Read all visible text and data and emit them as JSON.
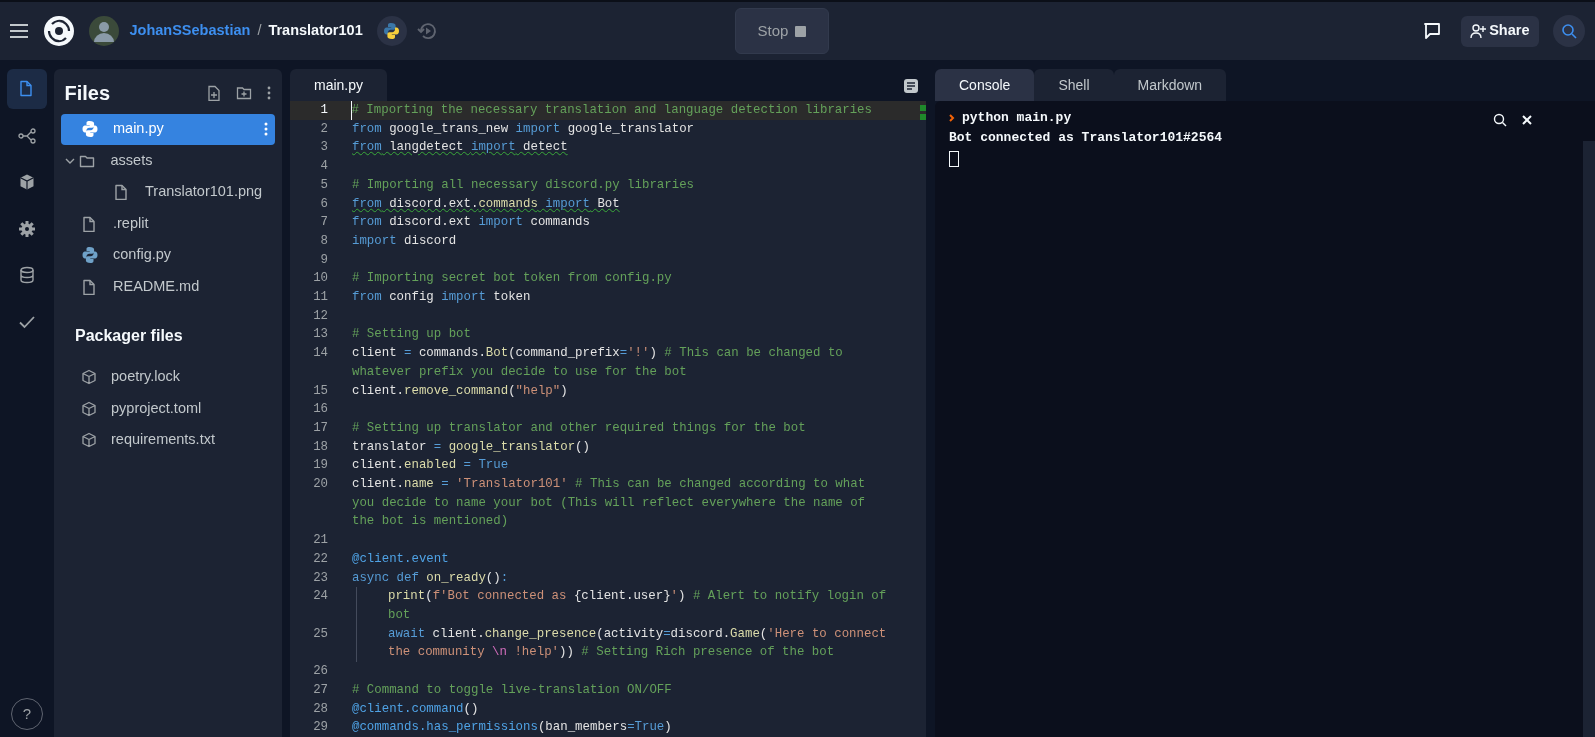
{
  "topbar": {
    "user": "JohanSSebastian",
    "separator": "/",
    "repl": "Translator101",
    "run_button": {
      "label": "Stop"
    },
    "share_button": {
      "label": "Share"
    }
  },
  "activity_bar": [
    {
      "kind": "files",
      "selected": true
    },
    {
      "kind": "git",
      "selected": false
    },
    {
      "kind": "packages",
      "selected": false
    },
    {
      "kind": "settings",
      "selected": false
    },
    {
      "kind": "database",
      "selected": false
    },
    {
      "kind": "tests",
      "selected": false
    }
  ],
  "help": "?",
  "files_panel": {
    "title": "Files",
    "items": [
      {
        "name": "main.py",
        "kind": "python",
        "selected": true
      },
      {
        "name": "assets",
        "kind": "folder",
        "selected": false,
        "expanded": true,
        "children": [
          {
            "name": "Translator101.png",
            "kind": "file",
            "selected": false
          }
        ]
      },
      {
        "name": ".replit",
        "kind": "file",
        "selected": false
      },
      {
        "name": "config.py",
        "kind": "python",
        "selected": false
      },
      {
        "name": "README.md",
        "kind": "file",
        "selected": false
      }
    ],
    "packager_title": "Packager files",
    "packager_items": [
      {
        "name": "poetry.lock"
      },
      {
        "name": "pyproject.toml"
      },
      {
        "name": "requirements.txt"
      }
    ]
  },
  "editor": {
    "tabs": [
      {
        "label": "main.py",
        "selected": true
      }
    ],
    "lines": [
      {
        "n": "1",
        "active": true,
        "rows": [
          {
            "tokens": [
              {
                "kind": "c",
                "text": "# Importing the necessary translation and language detection libraries"
              }
            ]
          }
        ]
      },
      {
        "n": "2",
        "rows": [
          {
            "tokens": [
              {
                "kind": "k",
                "text": "from"
              },
              {
                "kind": "t",
                "text": " google_trans_new "
              },
              {
                "kind": "k",
                "text": "import"
              },
              {
                "kind": "t",
                "text": " google_translator"
              }
            ]
          }
        ]
      },
      {
        "n": "3",
        "warning": true,
        "rows": [
          {
            "tokens": [
              {
                "kind": "k",
                "text": "from"
              },
              {
                "kind": "t",
                "text": " langdetect "
              },
              {
                "kind": "k",
                "text": "import"
              },
              {
                "kind": "t",
                "text": " detect"
              }
            ]
          }
        ]
      },
      {
        "n": "4",
        "rows": [
          {
            "tokens": []
          }
        ]
      },
      {
        "n": "5",
        "rows": [
          {
            "tokens": [
              {
                "kind": "c",
                "text": "# Importing all necessary discord.py libraries"
              }
            ]
          }
        ]
      },
      {
        "n": "6",
        "warning": true,
        "rows": [
          {
            "tokens": [
              {
                "kind": "k",
                "text": "from"
              },
              {
                "kind": "t",
                "text": " discord.ext."
              },
              {
                "kind": "f",
                "text": "commands"
              },
              {
                "kind": "k",
                "text": " import"
              },
              {
                "kind": "t",
                "text": " Bot"
              }
            ]
          }
        ]
      },
      {
        "n": "7",
        "rows": [
          {
            "tokens": [
              {
                "kind": "k",
                "text": "from"
              },
              {
                "kind": "t",
                "text": " discord.ext "
              },
              {
                "kind": "k",
                "text": "import"
              },
              {
                "kind": "t",
                "text": " commands"
              }
            ]
          }
        ]
      },
      {
        "n": "8",
        "rows": [
          {
            "tokens": [
              {
                "kind": "k",
                "text": "import"
              },
              {
                "kind": "t",
                "text": " discord"
              }
            ]
          }
        ]
      },
      {
        "n": "9",
        "rows": [
          {
            "tokens": []
          }
        ]
      },
      {
        "n": "10",
        "rows": [
          {
            "tokens": [
              {
                "kind": "c",
                "text": "# Importing secret bot token from config.py"
              }
            ]
          }
        ]
      },
      {
        "n": "11",
        "rows": [
          {
            "tokens": [
              {
                "kind": "k",
                "text": "from"
              },
              {
                "kind": "t",
                "text": " config "
              },
              {
                "kind": "k",
                "text": "import"
              },
              {
                "kind": "t",
                "text": " token"
              }
            ]
          }
        ]
      },
      {
        "n": "12",
        "rows": [
          {
            "tokens": []
          }
        ]
      },
      {
        "n": "13",
        "rows": [
          {
            "tokens": [
              {
                "kind": "c",
                "text": "# Setting up bot"
              }
            ]
          }
        ]
      },
      {
        "n": "14",
        "rows": [
          {
            "tokens": [
              {
                "kind": "t",
                "text": "client "
              },
              {
                "kind": "o",
                "text": "="
              },
              {
                "kind": "t",
                "text": " commands."
              },
              {
                "kind": "f",
                "text": "Bot"
              },
              {
                "kind": "t",
                "text": "(command_prefix"
              },
              {
                "kind": "o",
                "text": "="
              },
              {
                "kind": "s",
                "text": "'!'"
              },
              {
                "kind": "t",
                "text": ") "
              },
              {
                "kind": "c",
                "text": "# This can be changed to"
              }
            ]
          },
          {
            "tokens": [
              {
                "kind": "c",
                "text": "whatever prefix you decide to use for the bot"
              }
            ]
          }
        ]
      },
      {
        "n": "15",
        "rows": [
          {
            "tokens": [
              {
                "kind": "t",
                "text": "client."
              },
              {
                "kind": "f",
                "text": "remove_command"
              },
              {
                "kind": "t",
                "text": "("
              },
              {
                "kind": "s",
                "text": "\"help\""
              },
              {
                "kind": "t",
                "text": ")"
              }
            ]
          }
        ]
      },
      {
        "n": "16",
        "rows": [
          {
            "tokens": []
          }
        ]
      },
      {
        "n": "17",
        "rows": [
          {
            "tokens": [
              {
                "kind": "c",
                "text": "# Setting up translator and other required things for the bot"
              }
            ]
          }
        ]
      },
      {
        "n": "18",
        "rows": [
          {
            "tokens": [
              {
                "kind": "t",
                "text": "translator "
              },
              {
                "kind": "o",
                "text": "="
              },
              {
                "kind": "f",
                "text": " google_translator"
              },
              {
                "kind": "t",
                "text": "()"
              }
            ]
          }
        ]
      },
      {
        "n": "19",
        "rows": [
          {
            "tokens": [
              {
                "kind": "t",
                "text": "client."
              },
              {
                "kind": "f",
                "text": "enabled"
              },
              {
                "kind": "o",
                "text": " ="
              },
              {
                "kind": "k",
                "text": " True"
              }
            ]
          }
        ]
      },
      {
        "n": "20",
        "rows": [
          {
            "tokens": [
              {
                "kind": "t",
                "text": "client."
              },
              {
                "kind": "f",
                "text": "name"
              },
              {
                "kind": "o",
                "text": " ="
              },
              {
                "kind": "s",
                "text": " 'Translator101'"
              },
              {
                "kind": "c",
                "text": " # This can be changed according to what"
              }
            ]
          },
          {
            "tokens": [
              {
                "kind": "c",
                "text": "you decide to name your bot (This will reflect everywhere the name of"
              }
            ]
          },
          {
            "tokens": [
              {
                "kind": "c",
                "text": "the bot is mentioned)"
              }
            ]
          }
        ]
      },
      {
        "n": "21",
        "rows": [
          {
            "tokens": []
          }
        ]
      },
      {
        "n": "22",
        "rows": [
          {
            "tokens": [
              {
                "kind": "d",
                "text": "@client.event"
              }
            ]
          }
        ]
      },
      {
        "n": "23",
        "rows": [
          {
            "tokens": [
              {
                "kind": "k",
                "text": "async"
              },
              {
                "kind": "k",
                "text": " def"
              },
              {
                "kind": "f",
                "text": " on_ready"
              },
              {
                "kind": "t",
                "text": "()"
              },
              {
                "kind": "o",
                "text": ":"
              }
            ]
          }
        ]
      },
      {
        "n": "24",
        "indented": true,
        "rows": [
          {
            "tokens": [
              {
                "kind": "f",
                "text": "print"
              },
              {
                "kind": "t",
                "text": "("
              },
              {
                "kind": "s",
                "text": "f'Bot connected as "
              },
              {
                "kind": "t",
                "text": "{client.user}"
              },
              {
                "kind": "s",
                "text": "'"
              },
              {
                "kind": "t",
                "text": ") "
              },
              {
                "kind": "c",
                "text": "# Alert to notify login of"
              }
            ]
          },
          {
            "tokens": [
              {
                "kind": "c",
                "text": "bot"
              }
            ]
          }
        ]
      },
      {
        "n": "25",
        "indented": true,
        "rows": [
          {
            "tokens": [
              {
                "kind": "k",
                "text": "await"
              },
              {
                "kind": "t",
                "text": " client."
              },
              {
                "kind": "f",
                "text": "change_presence"
              },
              {
                "kind": "t",
                "text": "(activity"
              },
              {
                "kind": "o",
                "text": "="
              },
              {
                "kind": "t",
                "text": "discord."
              },
              {
                "kind": "f",
                "text": "Game"
              },
              {
                "kind": "t",
                "text": "("
              },
              {
                "kind": "s",
                "text": "'Here to connect"
              }
            ]
          },
          {
            "tokens": [
              {
                "kind": "s",
                "text": "the community "
              },
              {
                "kind": "e",
                "text": "\\n"
              },
              {
                "kind": "s",
                "text": " !help'"
              },
              {
                "kind": "t",
                "text": ")) "
              },
              {
                "kind": "c",
                "text": "# Setting Rich presence of the bot"
              }
            ]
          }
        ]
      },
      {
        "n": "26",
        "rows": [
          {
            "tokens": []
          }
        ]
      },
      {
        "n": "27",
        "rows": [
          {
            "tokens": [
              {
                "kind": "c",
                "text": "# Command to toggle live-translation ON/OFF"
              }
            ]
          }
        ]
      },
      {
        "n": "28",
        "rows": [
          {
            "tokens": [
              {
                "kind": "d",
                "text": "@client.command"
              },
              {
                "kind": "t",
                "text": "()"
              }
            ]
          }
        ]
      },
      {
        "n": "29",
        "rows": [
          {
            "tokens": [
              {
                "kind": "d",
                "text": "@commands.has_permissions"
              },
              {
                "kind": "t",
                "text": "(ban_members"
              },
              {
                "kind": "o",
                "text": "="
              },
              {
                "kind": "k",
                "text": "True"
              },
              {
                "kind": "t",
                "text": ")"
              }
            ]
          }
        ]
      }
    ]
  },
  "console": {
    "tabs": [
      {
        "label": "Console",
        "selected": true
      },
      {
        "label": "Shell",
        "selected": false
      },
      {
        "label": "Markdown",
        "selected": false
      }
    ],
    "command": "python main.py",
    "output": [
      "Bot connected as Translator101#2564"
    ]
  }
}
